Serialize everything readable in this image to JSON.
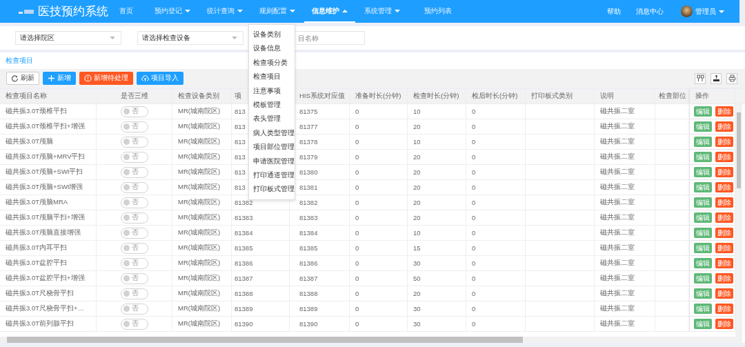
{
  "app": {
    "title": "医技预约系统"
  },
  "nav_items": [
    {
      "label": "首页",
      "dropdown": false,
      "expanded": false,
      "selected": false
    },
    {
      "label": "预约登记",
      "dropdown": true,
      "expanded": false,
      "selected": false
    },
    {
      "label": "统计查询",
      "dropdown": true,
      "expanded": false,
      "selected": false
    },
    {
      "label": "规则配置",
      "dropdown": true,
      "expanded": false,
      "selected": false
    },
    {
      "label": "信息维护",
      "dropdown": true,
      "expanded": true,
      "selected": true,
      "menu": [
        "设备类别",
        "设备信息",
        "检查项分类",
        "检查项目",
        "注意事项",
        "模板管理",
        "表头管理",
        "病人类型管理",
        "项目部位管理",
        "申请医院管理",
        "打印通道管理",
        "打印板式管理"
      ]
    },
    {
      "label": "系统管理",
      "dropdown": true,
      "expanded": false,
      "selected": false
    },
    {
      "label": "预约列表",
      "dropdown": false,
      "expanded": false,
      "selected": false
    }
  ],
  "nav_right": {
    "links": [
      "帮助",
      "消息中心"
    ],
    "user": "管理员"
  },
  "filters": {
    "campus_select": {
      "placeholder": "请选择院区"
    },
    "device_select": {
      "placeholder": "请选择检查设备"
    },
    "name_field": {
      "placeholder": "目名称"
    }
  },
  "section_title": "检查项目",
  "toolbar": {
    "buttons": [
      {
        "label": "刷新",
        "kind": "refresh"
      },
      {
        "label": "新增",
        "kind": "add"
      },
      {
        "label": "新增待处理",
        "kind": "pending"
      },
      {
        "label": "项目导入",
        "kind": "import"
      }
    ]
  },
  "table": {
    "columns": [
      "检查项目名称",
      "是否三维",
      "检查设备类别",
      "项",
      "HIS系统对应值",
      "准备时长(分钟)",
      "检查时长(分钟)",
      "检后时长(分钟)",
      "打印板式类别",
      "说明",
      "检查部位",
      "操作"
    ],
    "rows": [
      {
        "name": "磁共振3.0T颈椎平扫",
        "three_d": {
          "on": false,
          "label": "否"
        },
        "device": "MR(城南院区)",
        "code": "813",
        "his": "81375",
        "prep": "0",
        "exam": "10",
        "post": "0",
        "note": "磁共振二室",
        "actions": [
          "编辑",
          "删除"
        ]
      },
      {
        "name": "磁共振3.0T颈椎平扫+增强",
        "three_d": {
          "on": false,
          "label": "否"
        },
        "device": "MR(城南院区)",
        "code": "813",
        "his": "81377",
        "prep": "0",
        "exam": "20",
        "post": "0",
        "note": "磁共振二室",
        "actions": [
          "编辑",
          "删除"
        ]
      },
      {
        "name": "磁共振3.0T颅脑",
        "three_d": {
          "on": false,
          "label": "否"
        },
        "device": "MR(城南院区)",
        "code": "813",
        "his": "81378",
        "prep": "0",
        "exam": "10",
        "post": "0",
        "note": "磁共振二室",
        "actions": [
          "编辑",
          "删除"
        ]
      },
      {
        "name": "磁共振3.0T颅脑+MRV平扫",
        "three_d": {
          "on": false,
          "label": "否"
        },
        "device": "MR(城南院区)",
        "code": "813",
        "his": "81379",
        "prep": "0",
        "exam": "20",
        "post": "0",
        "note": "磁共振二室",
        "actions": [
          "编辑",
          "删除"
        ]
      },
      {
        "name": "磁共振3.0T颅脑+SWI平扫",
        "three_d": {
          "on": false,
          "label": "否"
        },
        "device": "MR(城南院区)",
        "code": "813",
        "his": "81380",
        "prep": "0",
        "exam": "20",
        "post": "0",
        "note": "磁共振二室",
        "actions": [
          "编辑",
          "删除"
        ]
      },
      {
        "name": "磁共振3.0T颅脑+SWI增强",
        "three_d": {
          "on": false,
          "label": "否"
        },
        "device": "MR(城南院区)",
        "code": "813",
        "his": "81381",
        "prep": "0",
        "exam": "20",
        "post": "0",
        "note": "磁共振二室",
        "actions": [
          "编辑",
          "删除"
        ]
      },
      {
        "name": "磁共振3.0T颅脑MRA",
        "three_d": {
          "on": false,
          "label": "否"
        },
        "device": "MR(城南院区)",
        "code": "81382",
        "his": "81382",
        "prep": "0",
        "exam": "20",
        "post": "0",
        "note": "磁共振二室",
        "actions": [
          "编辑",
          "删除"
        ]
      },
      {
        "name": "磁共振3.0T颅脑平扫+增强",
        "three_d": {
          "on": false,
          "label": "否"
        },
        "device": "MR(城南院区)",
        "code": "81383",
        "his": "81383",
        "prep": "0",
        "exam": "20",
        "post": "0",
        "note": "磁共振二室",
        "actions": [
          "编辑",
          "删除"
        ]
      },
      {
        "name": "磁共振3.0T颅脑直接增强",
        "three_d": {
          "on": false,
          "label": "否"
        },
        "device": "MR(城南院区)",
        "code": "81384",
        "his": "81384",
        "prep": "0",
        "exam": "10",
        "post": "0",
        "note": "磁共振二室",
        "actions": [
          "编辑",
          "删除"
        ]
      },
      {
        "name": "磁共振3.0T内耳平扫",
        "three_d": {
          "on": false,
          "label": "否"
        },
        "device": "MR(城南院区)",
        "code": "81385",
        "his": "81385",
        "prep": "0",
        "exam": "15",
        "post": "0",
        "note": "磁共振二室",
        "actions": [
          "编辑",
          "删除"
        ]
      },
      {
        "name": "磁共振3.0T盆腔平扫",
        "three_d": {
          "on": false,
          "label": "否"
        },
        "device": "MR(城南院区)",
        "code": "81386",
        "his": "81386",
        "prep": "0",
        "exam": "30",
        "post": "0",
        "note": "磁共振二室",
        "actions": [
          "编辑",
          "删除"
        ]
      },
      {
        "name": "磁共振3.0T盆腔平扫+增强",
        "three_d": {
          "on": false,
          "label": "否"
        },
        "device": "MR(城南院区)",
        "code": "81387",
        "his": "81387",
        "prep": "0",
        "exam": "50",
        "post": "0",
        "note": "磁共振二室",
        "actions": [
          "编辑",
          "删除"
        ]
      },
      {
        "name": "磁共振3.0T尺桡骨平扫",
        "three_d": {
          "on": false,
          "label": "否"
        },
        "device": "MR(城南院区)",
        "code": "81388",
        "his": "81388",
        "prep": "0",
        "exam": "20",
        "post": "0",
        "note": "磁共振二室",
        "actions": [
          "编辑",
          "删除"
        ]
      },
      {
        "name": "磁共振3.0T尺桡骨平扫+…",
        "three_d": {
          "on": false,
          "label": "否"
        },
        "device": "MR(城南院区)",
        "code": "81389",
        "his": "81389",
        "prep": "0",
        "exam": "30",
        "post": "0",
        "note": "磁共振二室",
        "actions": [
          "编辑",
          "删除"
        ]
      },
      {
        "name": "磁共振3.0T前列腺平扫",
        "three_d": {
          "on": false,
          "label": "否"
        },
        "device": "MR(城南院区)",
        "code": "81390",
        "his": "81390",
        "prep": "0",
        "exam": "30",
        "post": "0",
        "note": "磁共振二室",
        "actions": [
          "编辑",
          "删除"
        ]
      }
    ]
  }
}
